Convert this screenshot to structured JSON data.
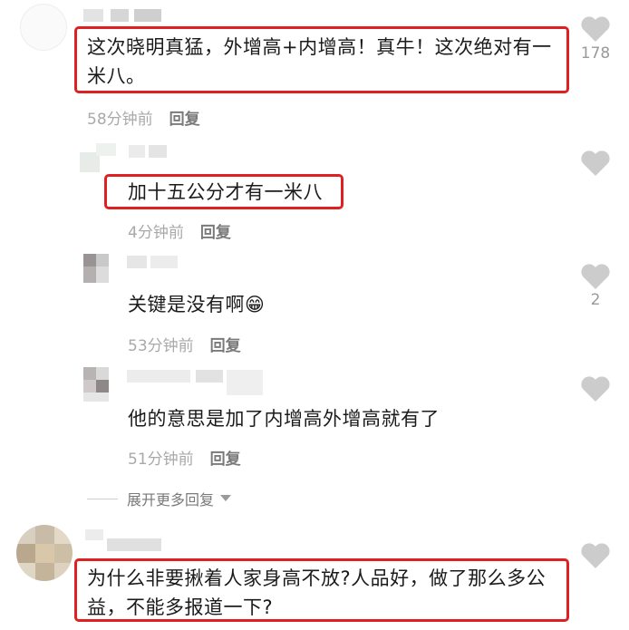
{
  "comments": [
    {
      "text": "这次晓明真猛，外增高+内增高！真牛！这次绝对有一米八。",
      "time": "58分钟前",
      "reply": "回复",
      "likes": "178"
    },
    {
      "text": "加十五公分才有一米八",
      "time": "4分钟前",
      "reply": "回复",
      "likes": ""
    },
    {
      "text": "关键是没有啊",
      "emoji": "😁",
      "time": "53分钟前",
      "reply": "回复",
      "likes": "2"
    },
    {
      "text": "他的意思是加了内增高外增高就有了",
      "time": "51分钟前",
      "reply": "回复",
      "likes": ""
    },
    {
      "text": "为什么非要揪着人家身高不放?人品好，做了那么多公益，不能多报道一下?",
      "likes": ""
    }
  ],
  "expand_replies": "展开更多回复",
  "icons": [
    "heart-icon",
    "chevron-down-icon",
    "avatar"
  ],
  "colors": {
    "highlight": "#e02020",
    "heart": "#cccccc",
    "muted": "#a9a9a9"
  }
}
